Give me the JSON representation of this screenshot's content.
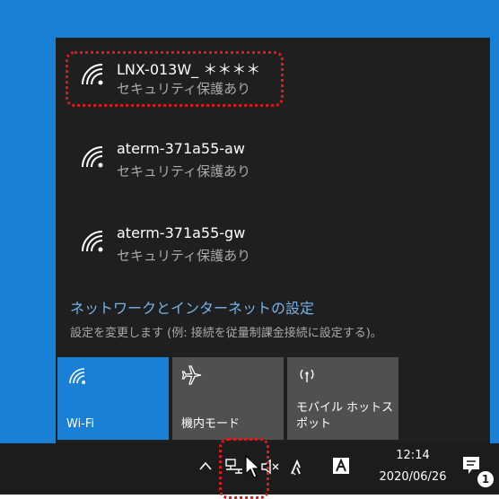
{
  "networks": [
    {
      "name": "LNX-013W_ ＊＊＊＊",
      "status": "セキュリティ保護あり"
    },
    {
      "name": "aterm-371a55-aw",
      "status": "セキュリティ保護あり"
    },
    {
      "name": "aterm-371a55-gw",
      "status": "セキュリティ保護あり"
    }
  ],
  "settings": {
    "link": "ネットワークとインターネットの設定",
    "description": "設定を変更します (例: 接続を従量制課金接続に設定する)。"
  },
  "tiles": {
    "wifi": "Wi-Fi",
    "airplane": "機内モード",
    "hotspot": "モバイル ホットス\nポット"
  },
  "taskbar": {
    "time": "12:14",
    "date": "2020/06/26",
    "notification_count": "1"
  },
  "colors": {
    "accent": "#1a80d6",
    "highlight": "#e0191b",
    "link": "#77b2ea"
  },
  "icons": {
    "network": "wifi-signal-icon",
    "airplane": "airplane-icon",
    "hotspot": "hotspot-icon",
    "show_hidden": "chevron-up-icon",
    "network_tray": "network-tray-icon",
    "volume": "volume-muted-icon",
    "notification": "action-center-icon"
  }
}
